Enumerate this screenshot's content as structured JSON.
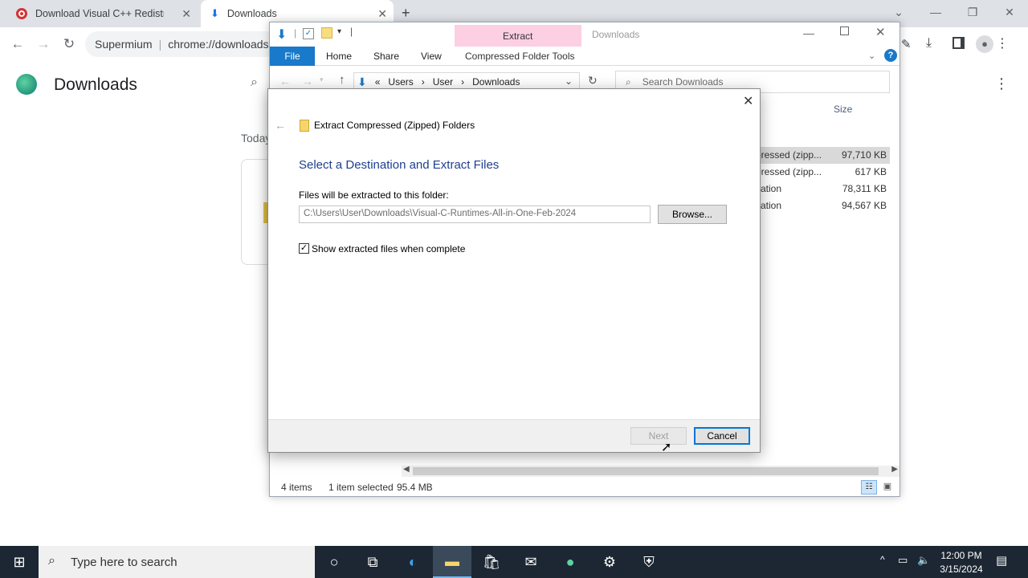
{
  "browser": {
    "tabs": [
      {
        "title": "Download Visual C++ Redistribu",
        "icon": "opera-red-icon"
      },
      {
        "title": "Downloads",
        "icon": "download-icon"
      }
    ],
    "omnibox": {
      "site": "Supermium",
      "url": "chrome://downloads"
    },
    "page_title": "Downloads",
    "today_label": "Today"
  },
  "explorer": {
    "title": "Downloads",
    "context_tab": "Extract",
    "ribbon_tabs": [
      "File",
      "Home",
      "Share",
      "View",
      "Compressed Folder Tools"
    ],
    "breadcrumb": [
      "«",
      "Users",
      "User",
      "Downloads"
    ],
    "search_placeholder": "Search Downloads",
    "size_header": "Size",
    "rows": [
      {
        "type": "pressed (zipp...",
        "size": "97,710 KB"
      },
      {
        "type": "pressed (zipp...",
        "size": "617 KB"
      },
      {
        "type": "cation",
        "size": "78,311 KB"
      },
      {
        "type": "cation",
        "size": "94,567 KB"
      }
    ],
    "status": {
      "items": "4 items",
      "selected": "1 item selected",
      "size": "95.4 MB"
    }
  },
  "dialog": {
    "window_title": "Extract Compressed (Zipped) Folders",
    "heading": "Select a Destination and Extract Files",
    "path_label": "Files will be extracted to this folder:",
    "path_value": "C:\\Users\\User\\Downloads\\Visual-C-Runtimes-All-in-One-Feb-2024",
    "browse_label": "Browse...",
    "checkbox_label": "Show extracted files when complete",
    "checkbox_checked": true,
    "next_label": "Next",
    "cancel_label": "Cancel"
  },
  "taskbar": {
    "search_placeholder": "Type here to search",
    "time": "12:00 PM",
    "date": "3/15/2024"
  },
  "colors": {
    "accent": "#1979ca",
    "dialog_heading": "#1e3f8f",
    "extract_tab": "#fccfe3",
    "taskbar": "#1c2733"
  }
}
